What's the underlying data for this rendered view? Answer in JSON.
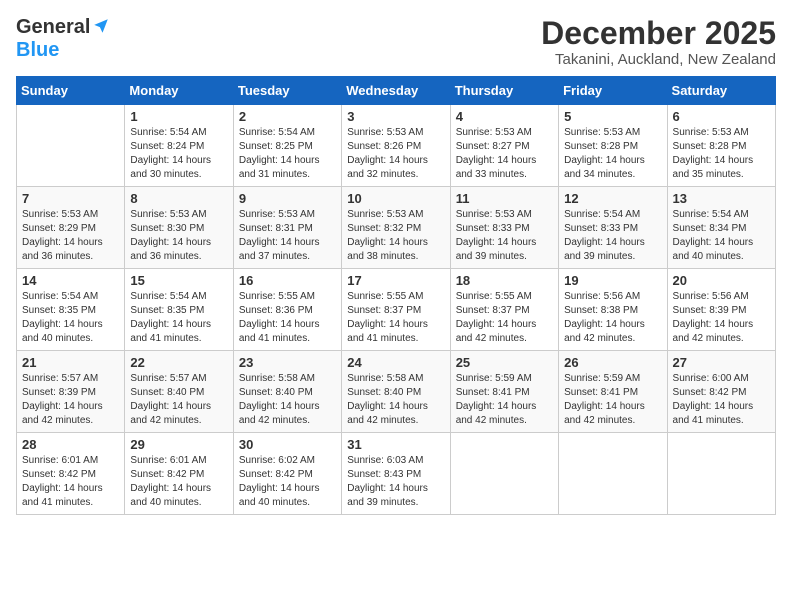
{
  "logo": {
    "general": "General",
    "blue": "Blue"
  },
  "title": "December 2025",
  "location": "Takanini, Auckland, New Zealand",
  "days_header": [
    "Sunday",
    "Monday",
    "Tuesday",
    "Wednesday",
    "Thursday",
    "Friday",
    "Saturday"
  ],
  "weeks": [
    [
      {
        "day": "",
        "info": ""
      },
      {
        "day": "1",
        "info": "Sunrise: 5:54 AM\nSunset: 8:24 PM\nDaylight: 14 hours\nand 30 minutes."
      },
      {
        "day": "2",
        "info": "Sunrise: 5:54 AM\nSunset: 8:25 PM\nDaylight: 14 hours\nand 31 minutes."
      },
      {
        "day": "3",
        "info": "Sunrise: 5:53 AM\nSunset: 8:26 PM\nDaylight: 14 hours\nand 32 minutes."
      },
      {
        "day": "4",
        "info": "Sunrise: 5:53 AM\nSunset: 8:27 PM\nDaylight: 14 hours\nand 33 minutes."
      },
      {
        "day": "5",
        "info": "Sunrise: 5:53 AM\nSunset: 8:28 PM\nDaylight: 14 hours\nand 34 minutes."
      },
      {
        "day": "6",
        "info": "Sunrise: 5:53 AM\nSunset: 8:28 PM\nDaylight: 14 hours\nand 35 minutes."
      }
    ],
    [
      {
        "day": "7",
        "info": "Sunrise: 5:53 AM\nSunset: 8:29 PM\nDaylight: 14 hours\nand 36 minutes."
      },
      {
        "day": "8",
        "info": "Sunrise: 5:53 AM\nSunset: 8:30 PM\nDaylight: 14 hours\nand 36 minutes."
      },
      {
        "day": "9",
        "info": "Sunrise: 5:53 AM\nSunset: 8:31 PM\nDaylight: 14 hours\nand 37 minutes."
      },
      {
        "day": "10",
        "info": "Sunrise: 5:53 AM\nSunset: 8:32 PM\nDaylight: 14 hours\nand 38 minutes."
      },
      {
        "day": "11",
        "info": "Sunrise: 5:53 AM\nSunset: 8:33 PM\nDaylight: 14 hours\nand 39 minutes."
      },
      {
        "day": "12",
        "info": "Sunrise: 5:54 AM\nSunset: 8:33 PM\nDaylight: 14 hours\nand 39 minutes."
      },
      {
        "day": "13",
        "info": "Sunrise: 5:54 AM\nSunset: 8:34 PM\nDaylight: 14 hours\nand 40 minutes."
      }
    ],
    [
      {
        "day": "14",
        "info": "Sunrise: 5:54 AM\nSunset: 8:35 PM\nDaylight: 14 hours\nand 40 minutes."
      },
      {
        "day": "15",
        "info": "Sunrise: 5:54 AM\nSunset: 8:35 PM\nDaylight: 14 hours\nand 41 minutes."
      },
      {
        "day": "16",
        "info": "Sunrise: 5:55 AM\nSunset: 8:36 PM\nDaylight: 14 hours\nand 41 minutes."
      },
      {
        "day": "17",
        "info": "Sunrise: 5:55 AM\nSunset: 8:37 PM\nDaylight: 14 hours\nand 41 minutes."
      },
      {
        "day": "18",
        "info": "Sunrise: 5:55 AM\nSunset: 8:37 PM\nDaylight: 14 hours\nand 42 minutes."
      },
      {
        "day": "19",
        "info": "Sunrise: 5:56 AM\nSunset: 8:38 PM\nDaylight: 14 hours\nand 42 minutes."
      },
      {
        "day": "20",
        "info": "Sunrise: 5:56 AM\nSunset: 8:39 PM\nDaylight: 14 hours\nand 42 minutes."
      }
    ],
    [
      {
        "day": "21",
        "info": "Sunrise: 5:57 AM\nSunset: 8:39 PM\nDaylight: 14 hours\nand 42 minutes."
      },
      {
        "day": "22",
        "info": "Sunrise: 5:57 AM\nSunset: 8:40 PM\nDaylight: 14 hours\nand 42 minutes."
      },
      {
        "day": "23",
        "info": "Sunrise: 5:58 AM\nSunset: 8:40 PM\nDaylight: 14 hours\nand 42 minutes."
      },
      {
        "day": "24",
        "info": "Sunrise: 5:58 AM\nSunset: 8:40 PM\nDaylight: 14 hours\nand 42 minutes."
      },
      {
        "day": "25",
        "info": "Sunrise: 5:59 AM\nSunset: 8:41 PM\nDaylight: 14 hours\nand 42 minutes."
      },
      {
        "day": "26",
        "info": "Sunrise: 5:59 AM\nSunset: 8:41 PM\nDaylight: 14 hours\nand 42 minutes."
      },
      {
        "day": "27",
        "info": "Sunrise: 6:00 AM\nSunset: 8:42 PM\nDaylight: 14 hours\nand 41 minutes."
      }
    ],
    [
      {
        "day": "28",
        "info": "Sunrise: 6:01 AM\nSunset: 8:42 PM\nDaylight: 14 hours\nand 41 minutes."
      },
      {
        "day": "29",
        "info": "Sunrise: 6:01 AM\nSunset: 8:42 PM\nDaylight: 14 hours\nand 40 minutes."
      },
      {
        "day": "30",
        "info": "Sunrise: 6:02 AM\nSunset: 8:42 PM\nDaylight: 14 hours\nand 40 minutes."
      },
      {
        "day": "31",
        "info": "Sunrise: 6:03 AM\nSunset: 8:43 PM\nDaylight: 14 hours\nand 39 minutes."
      },
      {
        "day": "",
        "info": ""
      },
      {
        "day": "",
        "info": ""
      },
      {
        "day": "",
        "info": ""
      }
    ]
  ]
}
